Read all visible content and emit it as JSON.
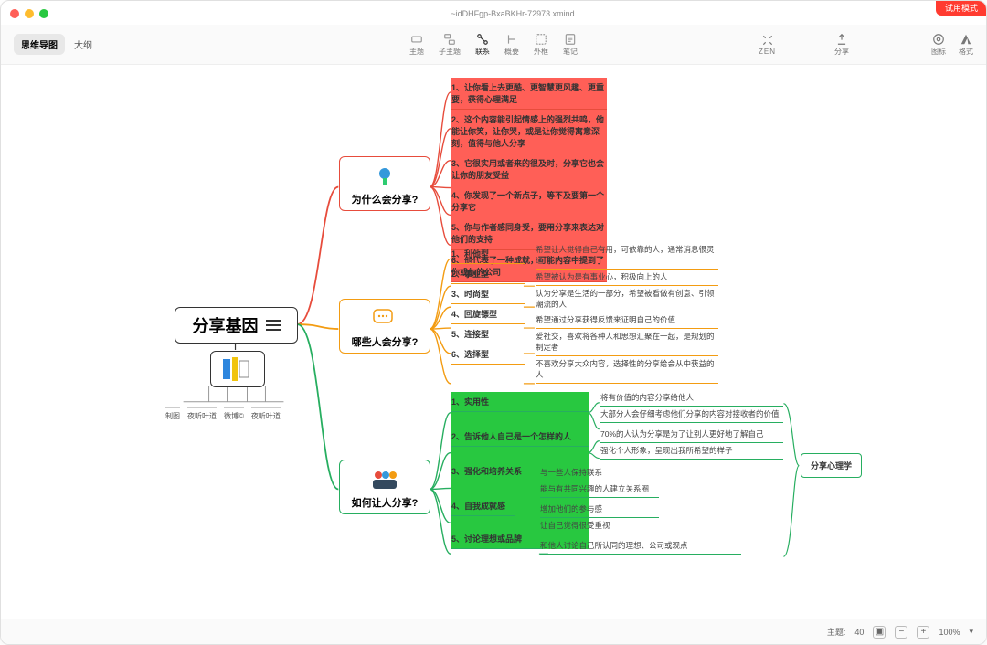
{
  "window": {
    "title": "~idDHFgp-BxaBKHr-72973.xmind",
    "trial_badge": "试用模式"
  },
  "tabs": {
    "active": "思维导图",
    "other": "大纲"
  },
  "toolbar": {
    "center": [
      {
        "k": "topic",
        "label": "主题"
      },
      {
        "k": "subtopic",
        "label": "子主题"
      },
      {
        "k": "relation",
        "label": "联系"
      },
      {
        "k": "summary",
        "label": "概要"
      },
      {
        "k": "boundary",
        "label": "外框"
      },
      {
        "k": "note",
        "label": "笔记"
      }
    ],
    "zen": "ZEN",
    "share": "分享",
    "right": [
      {
        "k": "theme",
        "label": "图标"
      },
      {
        "k": "format",
        "label": "格式"
      }
    ]
  },
  "root": {
    "title": "分享基因"
  },
  "attachments": [
    "制图",
    "夜听叶道",
    "微博©",
    "夜听叶道"
  ],
  "branches": {
    "why": {
      "title": "为什么会分享?"
    },
    "who": {
      "title": "哪些人会分享?"
    },
    "how": {
      "title": "如何让人分享?"
    }
  },
  "why_items": [
    "1、让你看上去更酷、更智慧更风趣、更重要，获得心理满足",
    "2、这个内容能引起情感上的强烈共鸣，他能让你笑，让你哭，或是让你觉得寓意深刻，值得与他人分享",
    "3、它很实用或者来的很及时，分享它也会让你的朋友受益",
    "4、你发现了一个新点子，等不及要第一个分享它",
    "5、你与作者感同身受，要用分享来表达对他们的支持",
    "6、他代表了一种成就，可能内容中提到了你或你的公司"
  ],
  "who_items": [
    {
      "k": "1、利他型",
      "d": "希望让人觉得自己有用，可依靠的人，通常消息很灵通"
    },
    {
      "k": "2、事业型",
      "d": "希望被认为是有事业心，积极向上的人"
    },
    {
      "k": "3、时尚型",
      "d": "认为分享是生活的一部分，希望被看做有创意、引领潮流的人"
    },
    {
      "k": "4、回旋镖型",
      "d": "希望通过分享获得反馈来证明自己的价值"
    },
    {
      "k": "5、连接型",
      "d": "爱社交，喜欢将各种人和思想汇聚在一起，是规划的制定者"
    },
    {
      "k": "6、选择型",
      "d": "不喜欢分享大众内容，选择性的分享给会从中获益的人"
    }
  ],
  "how_items": [
    {
      "k": "1、实用性",
      "d": [
        "将有价值的内容分享给他人",
        "大部分人会仔细考虑他们分享的内容对接收者的价值"
      ]
    },
    {
      "k": "2、告诉他人自己是一个怎样的人",
      "d": [
        "70%的人认为分享是为了让别人更好地了解自己",
        "强化个人形象，呈现出我所希望的样子"
      ]
    },
    {
      "k": "3、强化和培养关系",
      "d": [
        "与一些人保持联系",
        "能与有共同兴趣的人建立关系圈"
      ]
    },
    {
      "k": "4、自我成就感",
      "d": [
        "增加他们的参与感",
        "让自己觉得很受重视"
      ]
    },
    {
      "k": "5、讨论理想或品牌",
      "d": [
        "和他人讨论自己所认同的理想、公司或观点"
      ]
    }
  ],
  "right_box": "分享心理学",
  "status": {
    "topics_label": "主题:",
    "topics_count": "40",
    "zoom": "100%"
  },
  "colors": {
    "red": "#e74c3c",
    "orange": "#f39c12",
    "green": "#27ae60"
  }
}
